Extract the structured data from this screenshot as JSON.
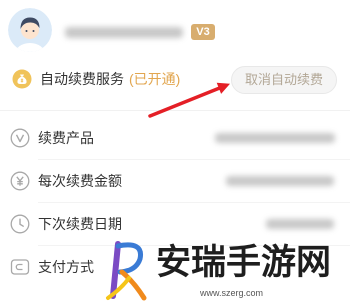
{
  "user": {
    "avatar_icon": "user-avatar-icon",
    "badge": "V3"
  },
  "auto_renew": {
    "icon": "money-bag-icon",
    "label": "自动续费服务",
    "status": "(已开通)",
    "cancel_button": "取消自动续费"
  },
  "details": [
    {
      "icon": "v-circle-icon",
      "label": "续费产品"
    },
    {
      "icon": "yuan-circle-icon",
      "label": "每次续费金额"
    },
    {
      "icon": "clock-icon",
      "label": "下次续费日期"
    },
    {
      "icon": "card-icon",
      "label": "支付方式"
    }
  ],
  "watermark": {
    "title": "安瑞手游网",
    "url": "www.szerg.com"
  },
  "colors": {
    "status": "#e2a64f",
    "badge": "#d8ad6e",
    "annotation_arrow": "#e41f26",
    "icon_stroke": "#a8a8a8"
  }
}
